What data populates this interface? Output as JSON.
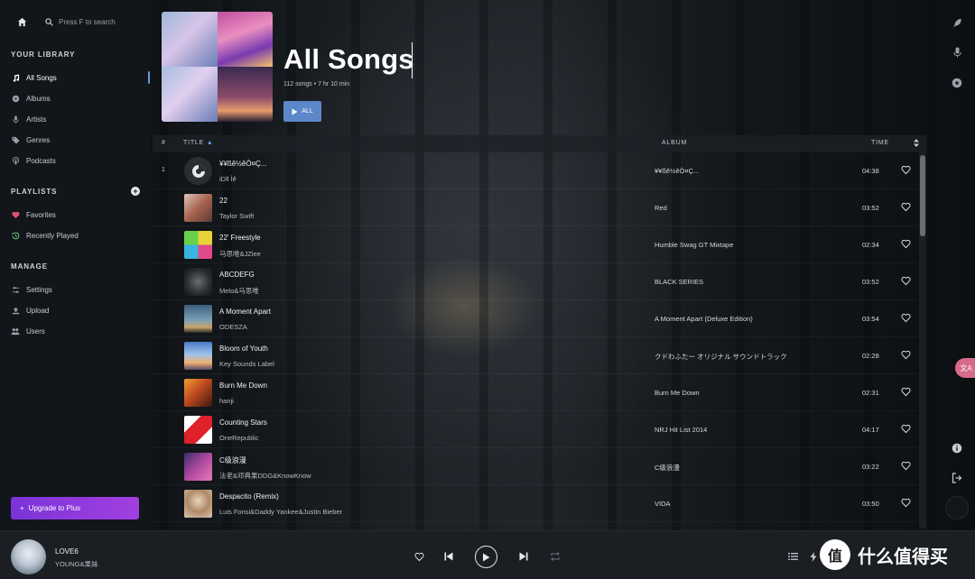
{
  "search": {
    "placeholder": "Press F to search"
  },
  "sidebar": {
    "library_title": "YOUR LIBRARY",
    "library_items": [
      {
        "label": "All Songs",
        "icon": "music-note-icon",
        "active": true
      },
      {
        "label": "Albums",
        "icon": "disc-icon"
      },
      {
        "label": "Artists",
        "icon": "microphone-icon"
      },
      {
        "label": "Genres",
        "icon": "tag-icon"
      },
      {
        "label": "Podcasts",
        "icon": "podcast-icon"
      }
    ],
    "playlists_title": "PLAYLISTS",
    "playlist_items": [
      {
        "label": "Favorites",
        "icon": "heart-icon"
      },
      {
        "label": "Recently Played",
        "icon": "history-icon"
      }
    ],
    "manage_title": "MANAGE",
    "manage_items": [
      {
        "label": "Settings",
        "icon": "sliders-icon"
      },
      {
        "label": "Upload",
        "icon": "upload-icon"
      },
      {
        "label": "Users",
        "icon": "users-icon"
      }
    ],
    "upgrade_label": "Upgrade to Plus"
  },
  "header": {
    "title": "All Songs",
    "subtitle": "112 songs • 7 hr 10 min",
    "play_all_label": "ALL"
  },
  "table": {
    "col_num": "#",
    "col_title": "TITLE",
    "col_album": "ALBUM",
    "col_time": "TIME",
    "rows": [
      {
        "num": "1",
        "name": "¥¥ßê½êÒ¤Ç...",
        "artist": "iDll Ìê",
        "album": "¥¥ßê½êÒ¤Ç...",
        "time": "04:38"
      },
      {
        "num": "",
        "name": "22",
        "artist": "Taylor Swift",
        "album": "Red",
        "time": "03:52"
      },
      {
        "num": "",
        "name": "22' Freestyle",
        "artist": "马思唯&JZlee",
        "album": "Humble Swag GT Mixtape",
        "time": "02:34"
      },
      {
        "num": "",
        "name": "ABCDEFG",
        "artist": "Melo&马思唯",
        "album": "BLACK SERIES",
        "time": "03:52"
      },
      {
        "num": "",
        "name": "A Moment Apart",
        "artist": "ODESZA",
        "album": "A Moment Apart (Deluxe Edition)",
        "time": "03:54"
      },
      {
        "num": "",
        "name": "Bloom of Youth",
        "artist": "Key Sounds Label",
        "album": "クドわふたー オリジナル サウンドトラック",
        "time": "02:28"
      },
      {
        "num": "",
        "name": "Burn Me Down",
        "artist": "hanji",
        "album": "Burn Me Down",
        "time": "02:31"
      },
      {
        "num": "",
        "name": "Counting Stars",
        "artist": "OneRepublic",
        "album": "NRJ Hit List 2014",
        "time": "04:17"
      },
      {
        "num": "",
        "name": "C级浪漫",
        "artist": "法老&邓典果DDG&KnowKnow",
        "album": "C级浪漫",
        "time": "03:22"
      },
      {
        "num": "",
        "name": "Despacito (Remix)",
        "artist": "Luis Fonsi&Daddy Yankee&Justin Bieber",
        "album": "VIDA",
        "time": "03:50"
      }
    ]
  },
  "player": {
    "title": "LOVE6",
    "artist": "YOUNG&果妹"
  },
  "watermark": {
    "text": "什么值得买",
    "badge": "值"
  },
  "translate_badge": "文A",
  "colors": {
    "accent": "#5c88c9",
    "upgrade": "#8b38dc",
    "badge": "#d66a8a"
  }
}
